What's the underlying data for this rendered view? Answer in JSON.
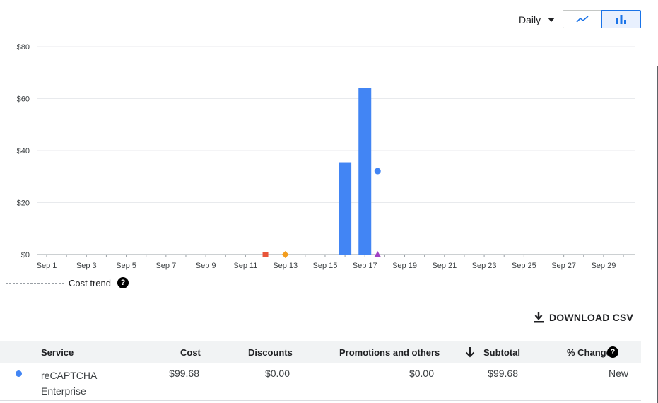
{
  "header": {
    "granularity": "Daily",
    "line_toggle_icon": "line-chart-icon",
    "bar_toggle_icon": "bar-chart-icon"
  },
  "colors": {
    "series": "#4285f4",
    "marker_red": "#e8553a",
    "marker_orange": "#f29d1e",
    "marker_purple": "#a142c4",
    "grid": "#e8eaed"
  },
  "chart_data": {
    "type": "bar",
    "x": [
      "Sep 1",
      "Sep 2",
      "Sep 3",
      "Sep 4",
      "Sep 5",
      "Sep 6",
      "Sep 7",
      "Sep 8",
      "Sep 9",
      "Sep 10",
      "Sep 11",
      "Sep 12",
      "Sep 13",
      "Sep 14",
      "Sep 15",
      "Sep 16",
      "Sep 17",
      "Sep 18",
      "Sep 19",
      "Sep 20",
      "Sep 21",
      "Sep 22",
      "Sep 23",
      "Sep 24",
      "Sep 25",
      "Sep 26",
      "Sep 27",
      "Sep 28",
      "Sep 29",
      "Sep 30"
    ],
    "x_tick_labels": [
      "Sep 1",
      "Sep 3",
      "Sep 5",
      "Sep 7",
      "Sep 9",
      "Sep 11",
      "Sep 13",
      "Sep 15",
      "Sep 17",
      "Sep 19",
      "Sep 21",
      "Sep 23",
      "Sep 25",
      "Sep 27",
      "Sep 29"
    ],
    "y_tick_labels": [
      "$0",
      "$20",
      "$40",
      "$60",
      "$80"
    ],
    "ylim": [
      0,
      80
    ],
    "series": [
      {
        "name": "reCAPTCHA Enterprise",
        "values": [
          0,
          0,
          0,
          0,
          0,
          0,
          0,
          0,
          0,
          0,
          0,
          0,
          0,
          0,
          0,
          35.5,
          64.2,
          0,
          0,
          0,
          0,
          0,
          0,
          0,
          0,
          0,
          0,
          0,
          0,
          0
        ]
      }
    ],
    "markers": [
      {
        "x": "Sep 12",
        "y": 0,
        "shape": "square",
        "color": "#e8553a"
      },
      {
        "x": "Sep 13",
        "y": 0,
        "shape": "diamond",
        "color": "#f29d1e"
      },
      {
        "x": "Sep 17",
        "y": 32.1,
        "shape": "circle",
        "color": "#4285f4"
      },
      {
        "x": "Sep 17",
        "y": 0,
        "shape": "triangle",
        "color": "#a142c4"
      }
    ],
    "grid": true
  },
  "legend": {
    "cost_trend_label": "Cost trend",
    "help_icon": "help-icon"
  },
  "download": {
    "label": "DOWNLOAD CSV",
    "icon": "download-icon"
  },
  "table": {
    "columns": {
      "service": "Service",
      "cost": "Cost",
      "discounts": "Discounts",
      "promotions": "Promotions and others",
      "subtotal": "Subtotal",
      "change": "% Change"
    },
    "sort_icon": "arrow-down-icon",
    "rows": [
      {
        "service": "reCAPTCHA Enterprise",
        "cost": "$99.68",
        "discounts": "$0.00",
        "promotions": "$0.00",
        "subtotal": "$99.68",
        "change": "New"
      }
    ]
  }
}
